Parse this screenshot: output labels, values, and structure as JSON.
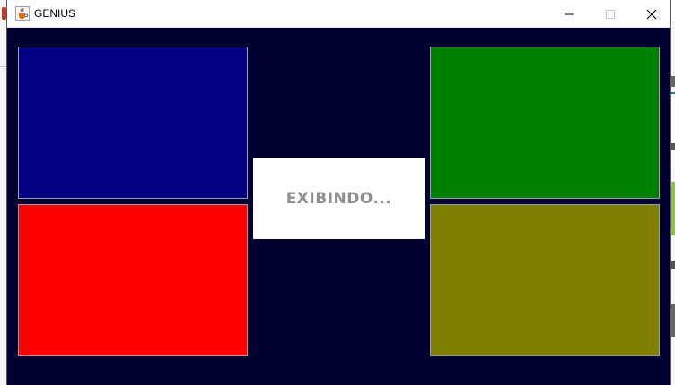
{
  "window": {
    "title": "GENIUS",
    "icon": "java-cup-icon",
    "controls": [
      "minimize-icon",
      "maximize-icon",
      "close-icon"
    ]
  },
  "game": {
    "status_text": "EXIBINDO...",
    "panels": [
      {
        "name": "blue",
        "color": "#000080"
      },
      {
        "name": "green",
        "color": "#008000"
      },
      {
        "name": "red",
        "color": "#ff0000"
      },
      {
        "name": "yellow",
        "color": "#808000"
      }
    ],
    "background_color": "#000030"
  }
}
